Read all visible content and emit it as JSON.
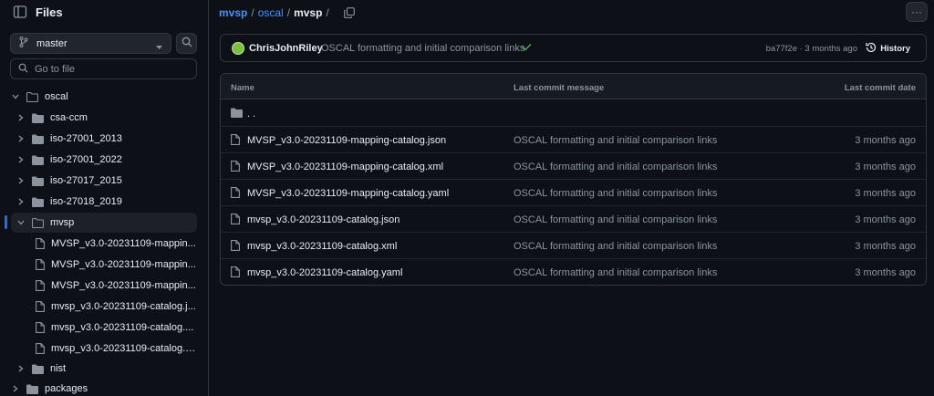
{
  "sidebar": {
    "title": "Files",
    "branch": "master",
    "goto_placeholder": "Go to file",
    "tree": {
      "oscal": "oscal",
      "csa_ccm": "csa-ccm",
      "iso_2013": "iso-27001_2013",
      "iso_2022": "iso-27001_2022",
      "iso_27017": "iso-27017_2015",
      "iso_27018": "iso-27018_2019",
      "mvsp": "mvsp",
      "f1": "MVSP_v3.0-20231109-mappin...",
      "f2": "MVSP_v3.0-20231109-mappin...",
      "f3": "MVSP_v3.0-20231109-mappin...",
      "f4": "mvsp_v3.0-20231109-catalog.j...",
      "f5": "mvsp_v3.0-20231109-catalog....",
      "f6": "mvsp_v3.0-20231109-catalog.y...",
      "nist": "nist",
      "packages": "packages"
    }
  },
  "breadcrumb": {
    "repo": "mvsp",
    "sep1": "/",
    "folder": "oscal",
    "sep2": "/",
    "current": "mvsp",
    "sep3": "/"
  },
  "more_label": "···",
  "commit": {
    "author": "ChrisJohnRiley",
    "message": "OSCAL formatting and initial comparison links",
    "meta": "ba77f2e · 3 months ago",
    "history_label": "History"
  },
  "table": {
    "headers": {
      "name": "Name",
      "message": "Last commit message",
      "date": "Last commit date"
    },
    "parent_label": ". .",
    "rows": [
      {
        "name": "MVSP_v3.0-20231109-mapping-catalog.json",
        "message": "OSCAL formatting and initial comparison links",
        "date": "3 months ago"
      },
      {
        "name": "MVSP_v3.0-20231109-mapping-catalog.xml",
        "message": "OSCAL formatting and initial comparison links",
        "date": "3 months ago"
      },
      {
        "name": "MVSP_v3.0-20231109-mapping-catalog.yaml",
        "message": "OSCAL formatting and initial comparison links",
        "date": "3 months ago"
      },
      {
        "name": "mvsp_v3.0-20231109-catalog.json",
        "message": "OSCAL formatting and initial comparison links",
        "date": "3 months ago"
      },
      {
        "name": "mvsp_v3.0-20231109-catalog.xml",
        "message": "OSCAL formatting and initial comparison links",
        "date": "3 months ago"
      },
      {
        "name": "mvsp_v3.0-20231109-catalog.yaml",
        "message": "OSCAL formatting and initial comparison links",
        "date": "3 months ago"
      }
    ]
  },
  "colors": {
    "background": "#0d1117",
    "border": "#30363d",
    "link": "#4493f8",
    "success": "#3fb950",
    "muted": "#8b949e",
    "selection_bar": "#1f6feb"
  },
  "icons": {
    "sidebar_toggle": "sidebar-toggle-icon",
    "branch": "git-branch-icon",
    "search": "search-icon",
    "folder": "folder-icon",
    "file": "file-icon",
    "copy": "copy-icon",
    "check": "check-icon",
    "history": "history-icon",
    "kebab": "kebab-horizontal-icon"
  }
}
